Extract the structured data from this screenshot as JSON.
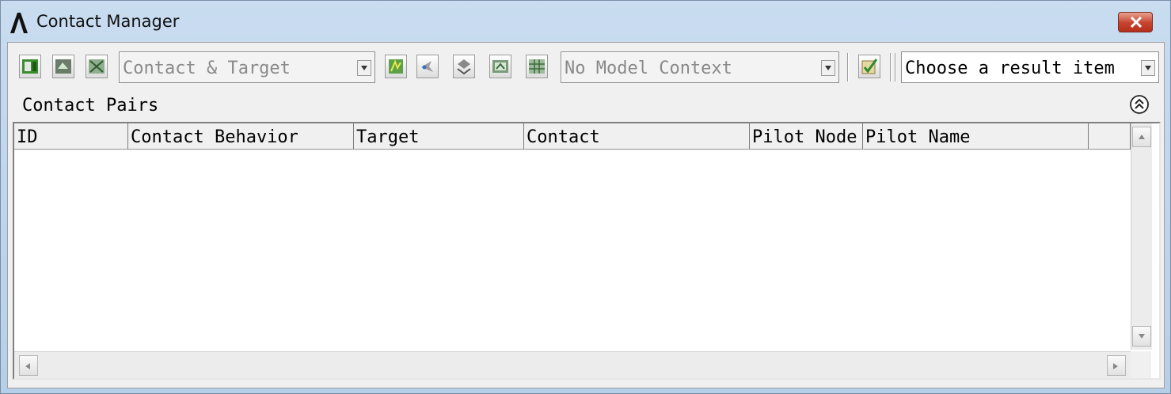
{
  "window": {
    "title": "Contact Manager",
    "icons": {
      "app": "ansys-logo-icon",
      "close": "close-icon"
    },
    "close_color": "#c6432e"
  },
  "toolbar": {
    "left_buttons": [
      "list-contact-icon",
      "select-contact-icon",
      "delete-contact-icon"
    ],
    "contact_target_select": {
      "value": "Contact & Target"
    },
    "middle_buttons": [
      "contact-wizard-icon",
      "pilot-node-icon",
      "flip-icon",
      "properties-icon",
      "table-icon"
    ],
    "model_context_select": {
      "value": "No Model Context"
    },
    "check_button": "check-contact-icon",
    "result_select": {
      "value": "Choose a result item"
    }
  },
  "section": {
    "label": "Contact Pairs",
    "collapse_icon": "double-chevron-up-icon"
  },
  "table": {
    "columns": [
      "ID",
      "Contact Behavior",
      "Target",
      "Contact",
      "Pilot Node",
      "Pilot Name",
      ""
    ],
    "rows": []
  }
}
